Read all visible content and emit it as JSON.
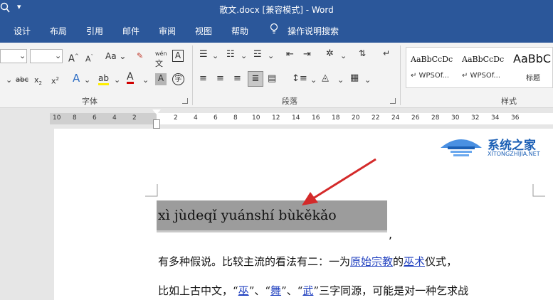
{
  "window": {
    "title": "散文.docx [兼容模式] - Word",
    "qa_icon": "search-icon",
    "qa_dropdown": "▾"
  },
  "menu": {
    "tabs": [
      "设计",
      "布局",
      "引用",
      "邮件",
      "审阅",
      "视图",
      "帮助"
    ],
    "tell_me": "操作说明搜索"
  },
  "ribbon": {
    "font_group_label": "字体",
    "paragraph_group_label": "段落",
    "styles_group_label": "样式",
    "font_case": "Aa",
    "wen_label": "wén",
    "styles": [
      {
        "sample": "AaBbCcDc",
        "name": "↵ WPSOf..."
      },
      {
        "sample": "AaBbCcDc",
        "name": "↵ WPSOf..."
      },
      {
        "sample": "AaBbC",
        "name": "标题"
      }
    ]
  },
  "ruler": {
    "numbers": [
      "10",
      "8",
      "6",
      "4",
      "2",
      "2",
      "4",
      "6",
      "8",
      "10",
      "12",
      "14",
      "16",
      "18",
      "20",
      "22",
      "24",
      "26",
      "28",
      "30",
      "32",
      "34",
      "36"
    ]
  },
  "document": {
    "pinyin_line": "xì jùdeqǐ yuánshí bùkěkǎo",
    "comma": ",",
    "line2": {
      "before": "有多种假说。比较主流的看法有二：一为",
      "link1": "原始宗教",
      "mid": "的",
      "link2": "巫术",
      "after": "仪式，"
    },
    "line3": {
      "before": "比如上古中文，“",
      "link1": "巫",
      "sep1": "”、“",
      "link2": "舞",
      "sep2": "”、“",
      "link3": "武",
      "after": "”三字同源，可能是对一种乞求战"
    }
  },
  "watermark": {
    "name": "系统之家",
    "url": "XITONGZHIJIA.NET"
  },
  "colors": {
    "accent": "#2b579a",
    "highlight": "#9c9c9c",
    "arrow": "#d42a2a",
    "link": "#1f3fbf"
  }
}
